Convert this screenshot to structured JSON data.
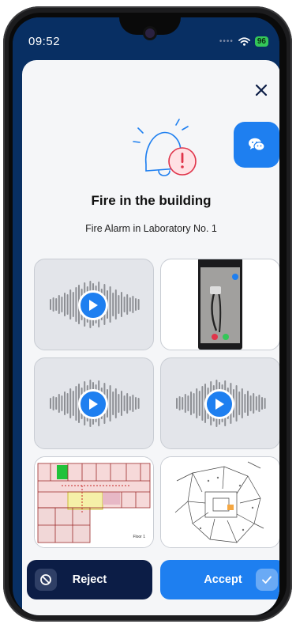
{
  "status_bar": {
    "time": "09:52",
    "battery": "96"
  },
  "alert": {
    "title": "Fire in the building",
    "subtitle": "Fire Alarm in Laboratory No. 1"
  },
  "media": [
    {
      "type": "audio",
      "icon": "play-icon"
    },
    {
      "type": "video",
      "icon": "phone-video-thumbnail"
    },
    {
      "type": "audio",
      "icon": "play-icon"
    },
    {
      "type": "audio",
      "icon": "play-icon"
    },
    {
      "type": "floor-plan",
      "label": "Floor 1"
    },
    {
      "type": "floor-plan"
    }
  ],
  "actions": {
    "reject_label": "Reject",
    "accept_label": "Accept"
  },
  "colors": {
    "primary": "#1e7ff0",
    "dark": "#0c1d46",
    "alarm": "#e0344a"
  }
}
